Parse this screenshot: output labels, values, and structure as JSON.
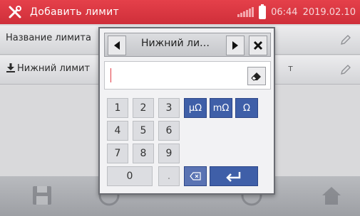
{
  "status_bar": {
    "title": "Добавить лимит",
    "time": "06:44",
    "date": "2019.02.10",
    "icons": [
      "tools-icon",
      "signal-icon",
      "battery-icon"
    ]
  },
  "rows": [
    {
      "label": "Название лимита",
      "icon": "",
      "value": ""
    },
    {
      "label": "Нижний лимит",
      "icon": "download-arrow-icon",
      "value": "т"
    }
  ],
  "dialog": {
    "title": "Нижний ли…",
    "prev_icon": "arrow-left-icon",
    "next_icon": "arrow-right-icon",
    "close_icon": "close-icon",
    "input_value": "",
    "clear_icon": "eraser-icon"
  },
  "keypad": {
    "digits": [
      "1",
      "2",
      "3",
      "4",
      "5",
      "6",
      "7",
      "8",
      "9",
      "0",
      "."
    ],
    "units": [
      "μΩ",
      "mΩ",
      "Ω"
    ],
    "backspace_icon": "backspace-icon",
    "enter_icon": "enter-icon"
  },
  "colors": {
    "status_bar": "#d93641",
    "unit_keys": "#3f5fa8"
  },
  "bottom_bar_icons": [
    "save-icon",
    "cancel-icon",
    "info-icon",
    "home-icon"
  ]
}
